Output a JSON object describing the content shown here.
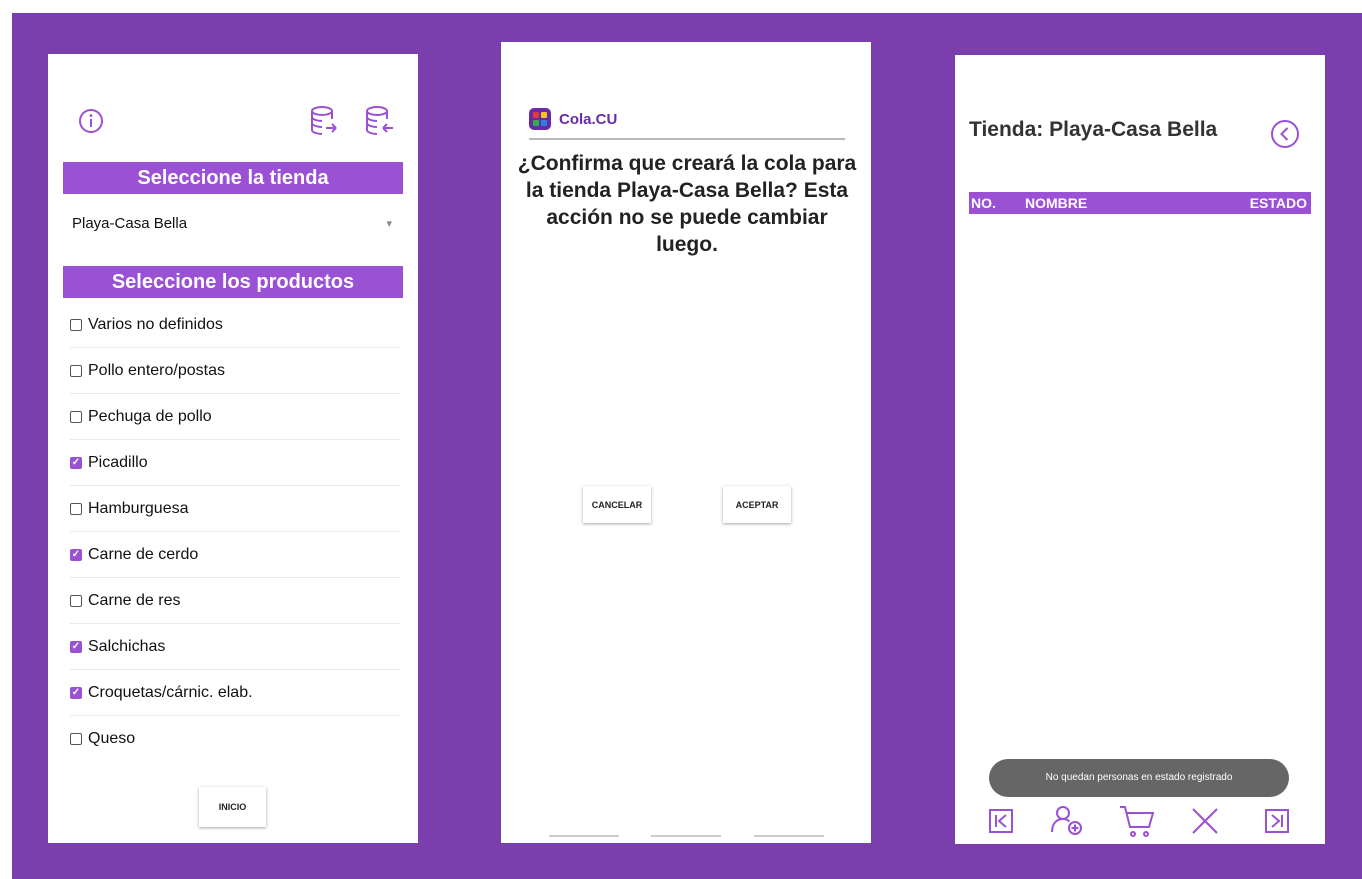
{
  "screen1": {
    "store_header": "Seleccione la tienda",
    "store_selected": "Playa-Casa Bella",
    "products_header": "Seleccione los productos",
    "products": [
      {
        "label": "Varios no definidos",
        "checked": false
      },
      {
        "label": "Pollo entero/postas",
        "checked": false
      },
      {
        "label": "Pechuga de pollo",
        "checked": false
      },
      {
        "label": "Picadillo",
        "checked": true
      },
      {
        "label": "Hamburguesa",
        "checked": false
      },
      {
        "label": "Carne de cerdo",
        "checked": true
      },
      {
        "label": "Carne de res",
        "checked": false
      },
      {
        "label": "Salchichas",
        "checked": true
      },
      {
        "label": "Croquetas/cárnic. elab.",
        "checked": true
      },
      {
        "label": "Queso",
        "checked": false
      }
    ],
    "start_button": "INICIO"
  },
  "screen2": {
    "app_title": "Cola.CU",
    "confirm_text": "¿Confirma que creará la cola para la tienda Playa-Casa Bella? Esta acción no se puede cambiar luego.",
    "cancel_button": "CANCELAR",
    "accept_button": "ACEPTAR"
  },
  "screen3": {
    "title": "Tienda: Playa-Casa Bella",
    "columns": {
      "no": "NO.",
      "name": "NOMBRE",
      "status": "ESTADO"
    },
    "toast": "No quedan personas en estado registrado"
  },
  "icons": [
    "info-icon",
    "database-import-icon",
    "database-export-icon",
    "back-icon",
    "first-page-icon",
    "add-person-icon",
    "cart-icon",
    "close-icon",
    "last-page-icon"
  ],
  "colors": {
    "background": "#7b3fad",
    "accent": "#9b51d4",
    "app_logo": "#6a2aa8"
  }
}
